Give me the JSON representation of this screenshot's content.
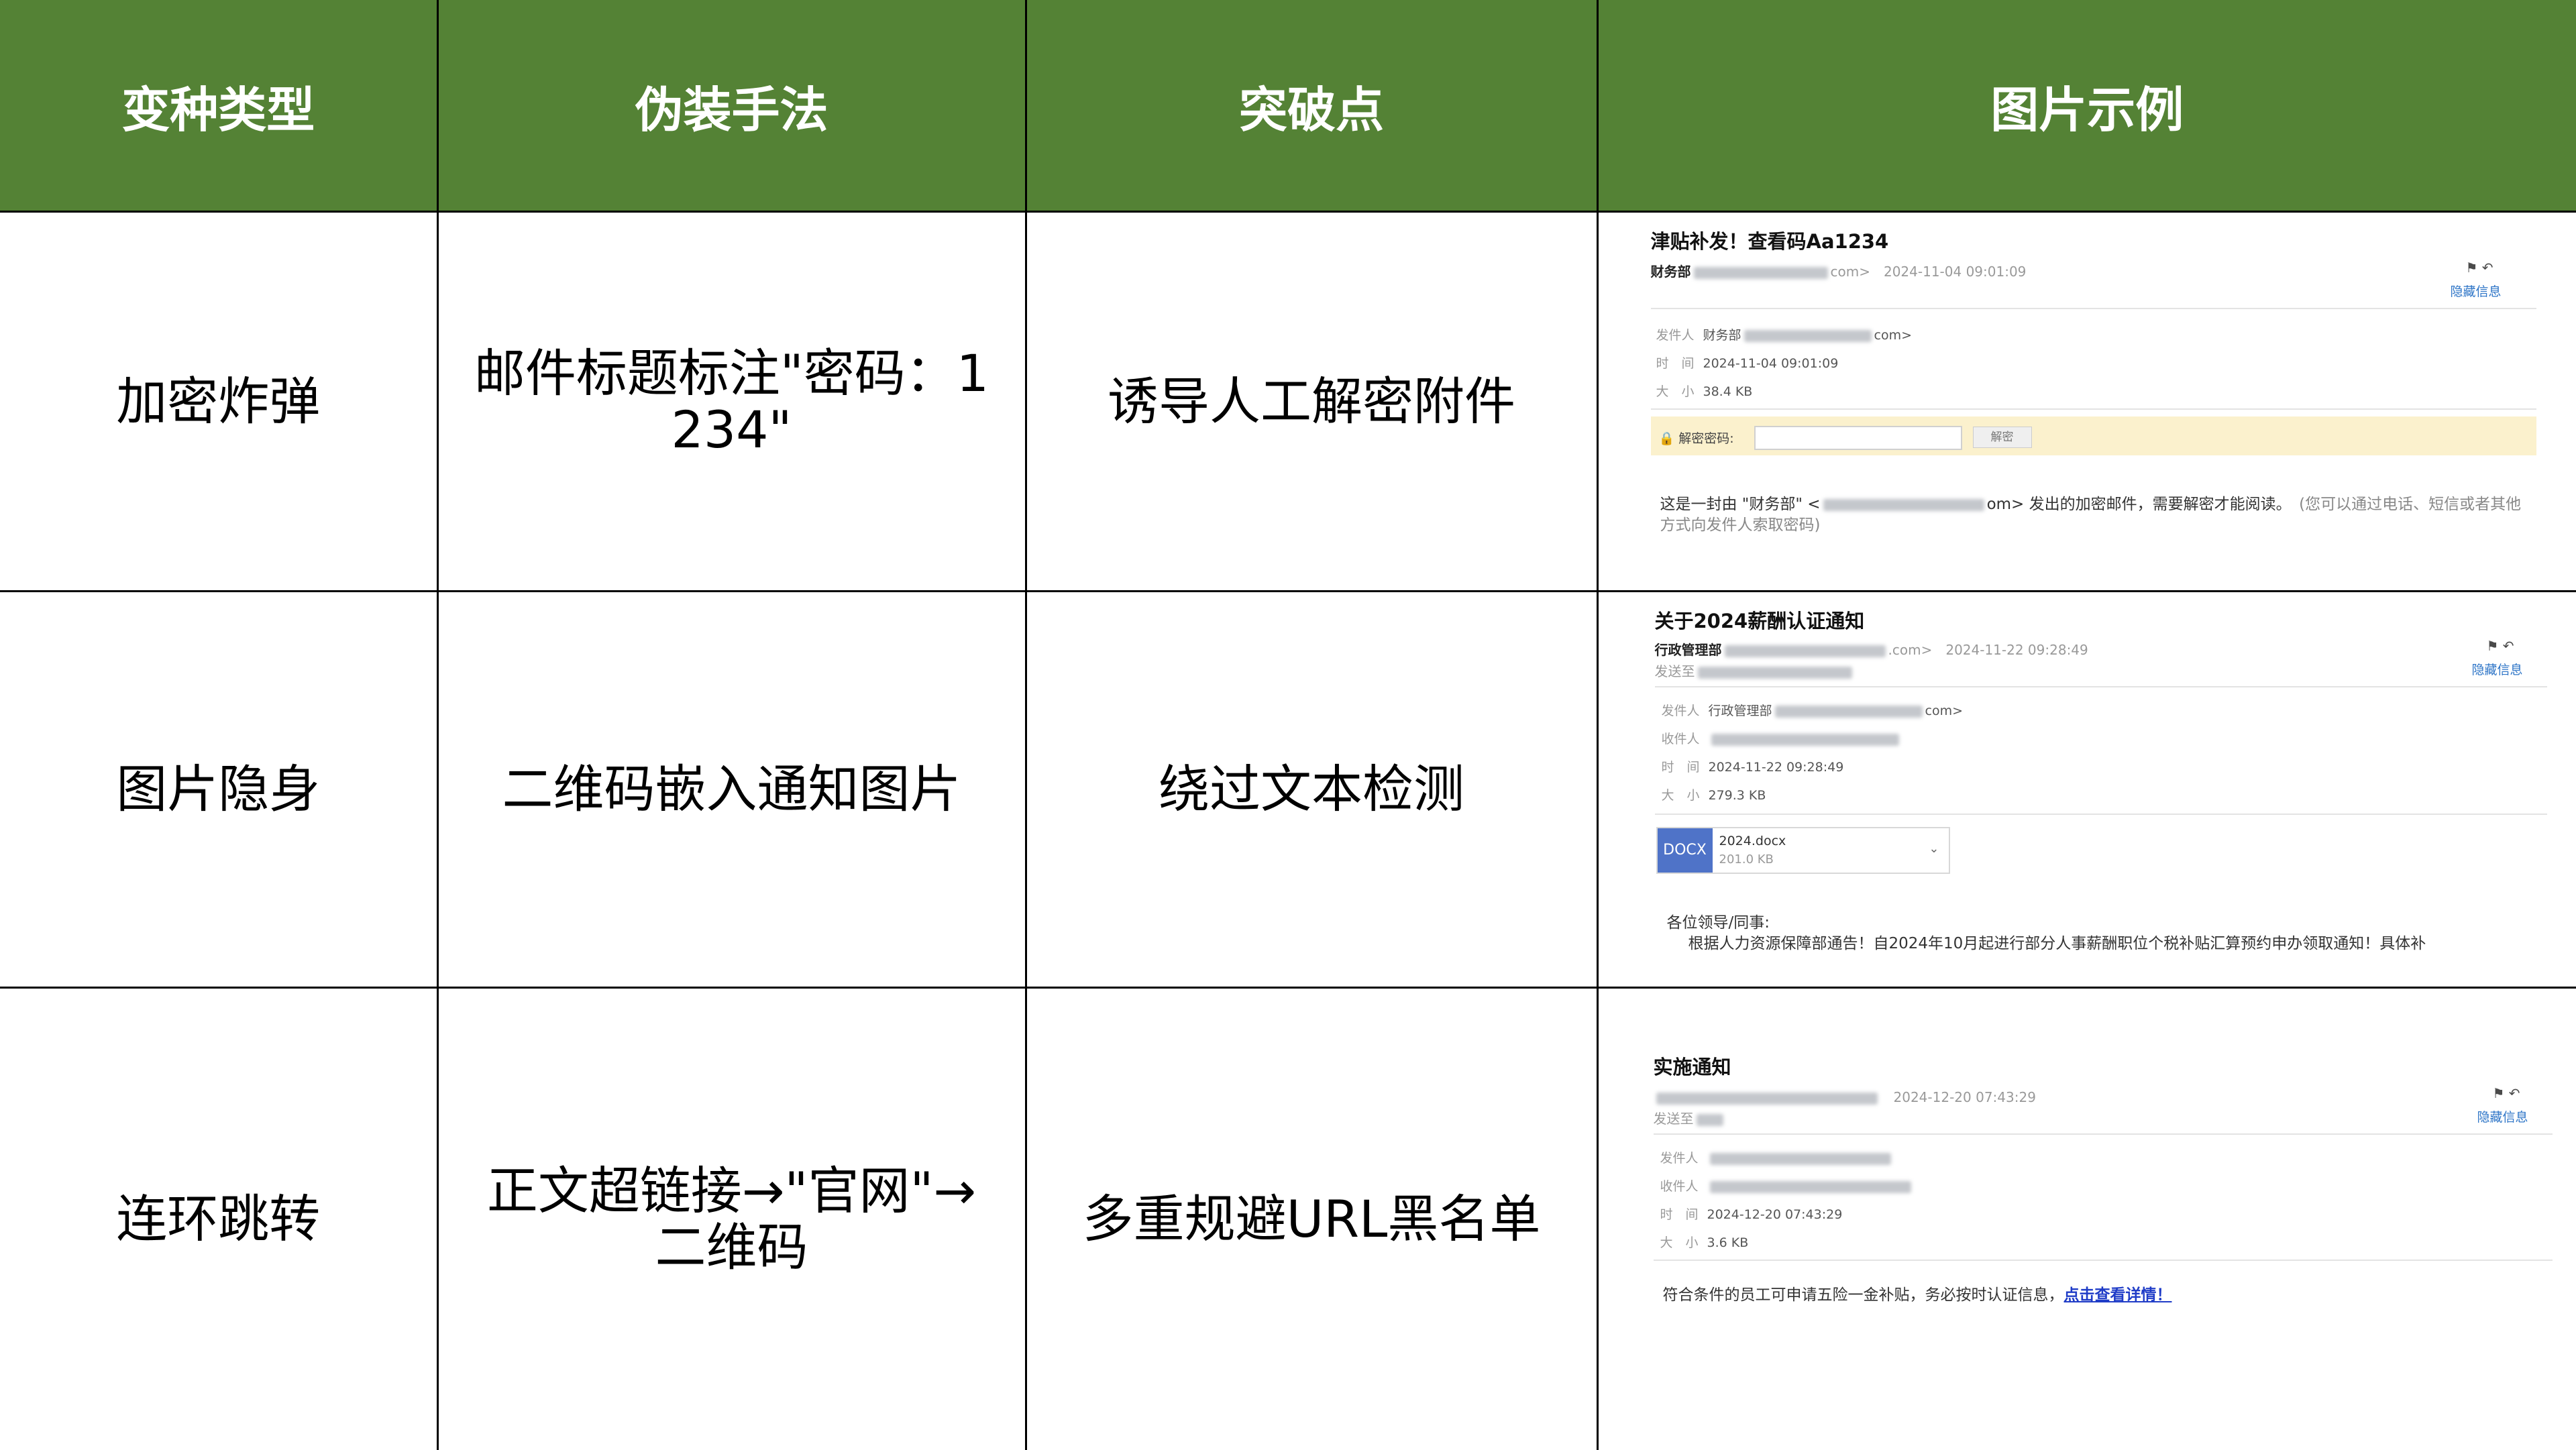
{
  "headers": [
    "变种类型",
    "伪装手法",
    "突破点",
    "图片示例"
  ],
  "rows": [
    {
      "type": "加密炸弹",
      "method": "邮件标题标注\"密码：1234\"",
      "breakthrough": "诱导人工解密附件"
    },
    {
      "type": "图片隐身",
      "method": "二维码嵌入通知图片",
      "breakthrough": "绕过文本检测"
    },
    {
      "type": "连环跳转",
      "method": "正文超链接→\"官网\"→二维码",
      "breakthrough": "多重规避URL黑名单"
    }
  ],
  "examples": {
    "email1": {
      "subject": "津贴补发！查看码Aa1234",
      "sender": "财务部",
      "sender_suffix": "com>",
      "date": "2024-11-04 09:01:09",
      "hide_label": "隐藏信息",
      "meta_from_label": "发件人",
      "meta_from_value": "财务部",
      "meta_from_suffix": "com>",
      "meta_time_label": "时　间",
      "meta_time": "2024-11-04 09:01:09",
      "meta_size_label": "大　小",
      "meta_size": "38.4 KB",
      "pw_label": "解密密码:",
      "pw_button": "解密",
      "body_prefix": "这是一封由 \"财务部\" <",
      "body_suffix": "om> 发出的加密邮件，需要解密才能阅读。",
      "body_note": "(您可以通过电话、短信或者其他方式向发件人索取密码)"
    },
    "email2": {
      "subject": "关于2024薪酬认证通知",
      "sender": "行政管理部",
      "sender_suffix": ".com>",
      "date": "2024-11-22 09:28:49",
      "to_label": "发送至",
      "hide_label": "隐藏信息",
      "meta_from_label": "发件人",
      "meta_from_value": "行政管理部",
      "meta_from_suffix": "com>",
      "meta_to_label": "收件人",
      "meta_time_label": "时　间",
      "meta_time": "2024-11-22 09:28:49",
      "meta_size_label": "大　小",
      "meta_size": "279.3 KB",
      "att_type": "DOCX",
      "att_name": "2024.docx",
      "att_size": "201.0 KB",
      "greeting": "各位领导/同事:",
      "body": "根据人力资源保障部通告！自2024年10月起进行部分人事薪酬职位个税补贴汇算预约申办领取通知！具体补"
    },
    "email3": {
      "subject": "实施通知",
      "date": "2024-12-20 07:43:29",
      "to_label": "发送至",
      "hide_label": "隐藏信息",
      "meta_from_label": "发件人",
      "meta_to_label": "收件人",
      "meta_time_label": "时　间",
      "meta_time": "2024-12-20 07:43:29",
      "meta_size_label": "大　小",
      "meta_size": "3.6 KB",
      "body": "符合条件的员工可申请五险一金补贴，务必按时认证信息，",
      "link": "点击查看详情！"
    }
  },
  "colors": {
    "header_bg": "#548235",
    "header_text": "#ffffff",
    "link": "#1f3cc7",
    "hide_link": "#2e75c7",
    "pw_bar": "#fbf1cd"
  }
}
